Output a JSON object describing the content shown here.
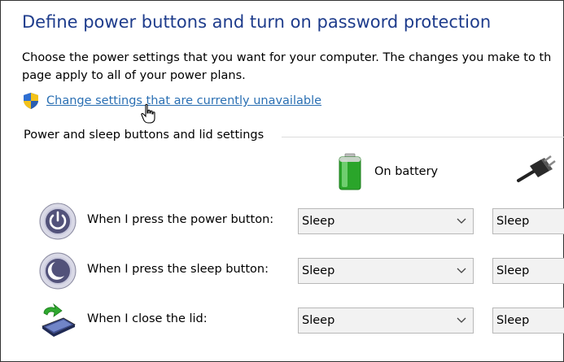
{
  "page": {
    "title": "Define power buttons and turn on password protection",
    "description_line1": "Choose the power settings that you want for your computer. The changes you make to th",
    "description_line2": "page apply to all of your power plans.",
    "change_settings_link": "Change settings that are currently unavailable",
    "section_header": "Power and sleep buttons and lid settings"
  },
  "columns": {
    "battery": "On battery",
    "plugged": ""
  },
  "rows": [
    {
      "label": "When I press the power button:",
      "battery_value": "Sleep",
      "plugged_value": "Sleep",
      "icon": "power-button-icon"
    },
    {
      "label": "When I press the sleep button:",
      "battery_value": "Sleep",
      "plugged_value": "Sleep",
      "icon": "sleep-button-icon"
    },
    {
      "label": "When I close the lid:",
      "battery_value": "Sleep",
      "plugged_value": "Sleep",
      "icon": "laptop-lid-icon"
    }
  ],
  "colors": {
    "title": "#1e3c8c",
    "link": "#2a6fb3",
    "dropdown_bg": "#f2f2f2",
    "dropdown_border": "#b8b8b8"
  }
}
